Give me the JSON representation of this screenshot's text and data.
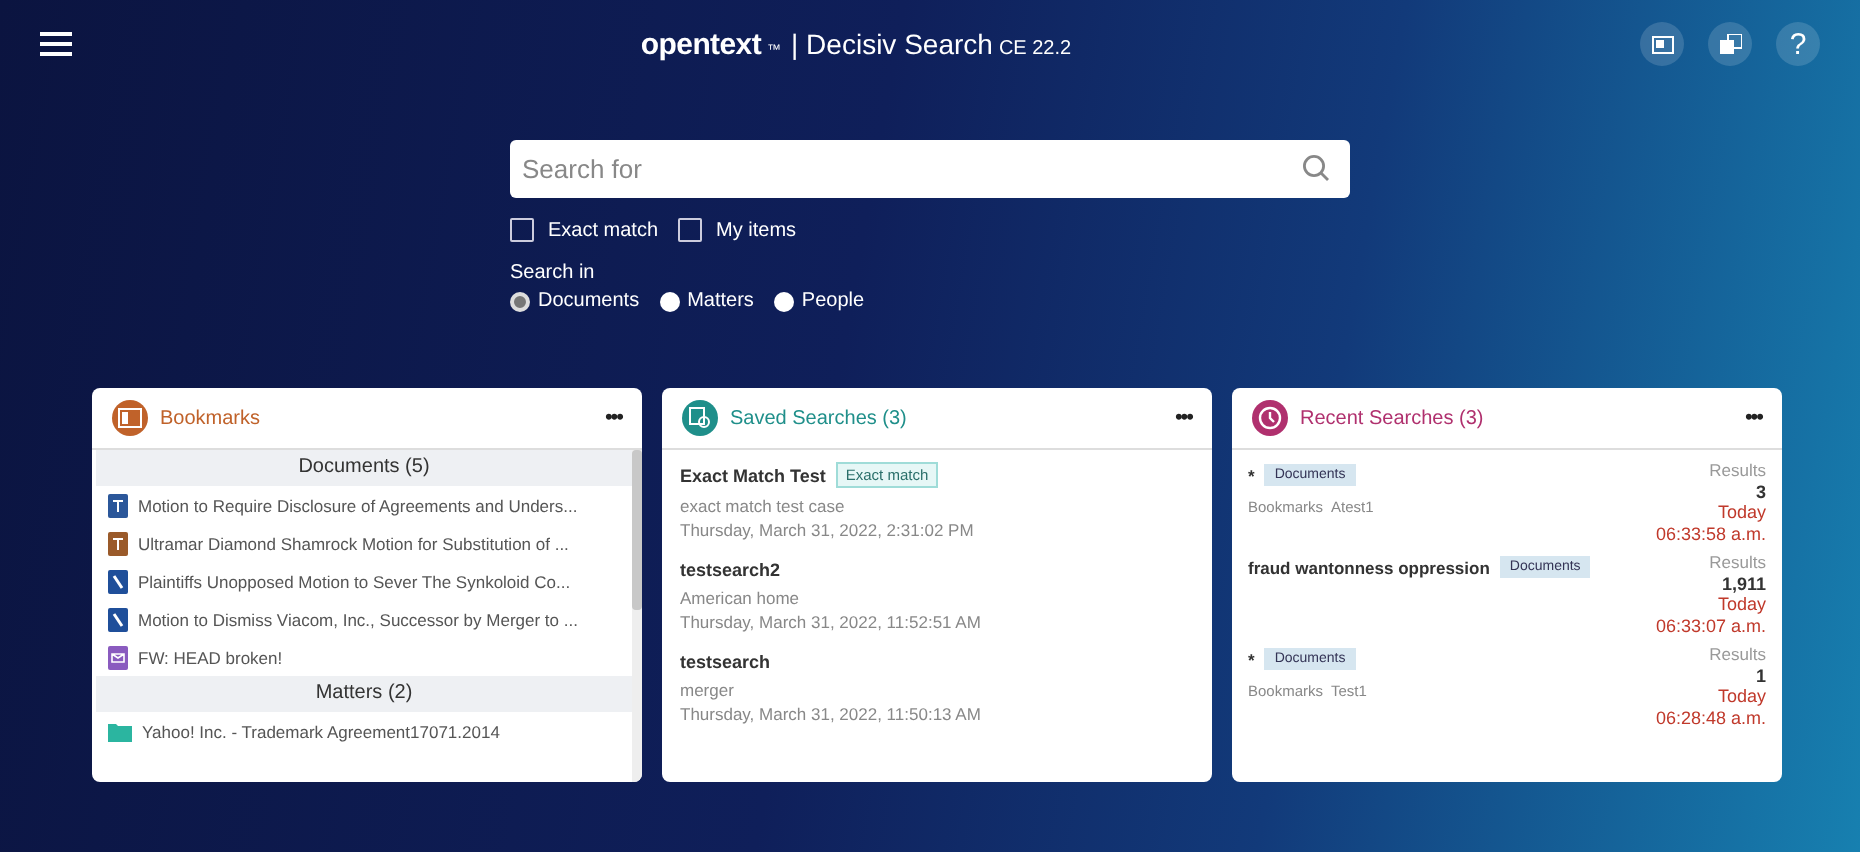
{
  "header": {
    "brand": "opentext",
    "brand_mark": "™",
    "title": "| Decisiv Search",
    "version": "CE 22.2",
    "help": "?"
  },
  "search": {
    "placeholder": "Search for"
  },
  "options": [
    {
      "label": "Exact match",
      "checked": false
    },
    {
      "label": "My items",
      "checked": false
    }
  ],
  "search_in": {
    "label": "Search in",
    "choices": [
      {
        "label": "Documents",
        "selected": true
      },
      {
        "label": "Matters",
        "selected": false
      },
      {
        "label": "People",
        "selected": false
      }
    ]
  },
  "bookmarks": {
    "title": "Bookmarks",
    "color": "#c0622a",
    "more": "•••",
    "groups": [
      {
        "heading": "Documents (5)",
        "items": [
          {
            "kind": "word",
            "text": "Motion to Require Disclosure of Agreements and Unders..."
          },
          {
            "kind": "tiff",
            "text": "Ultramar Diamond Shamrock Motion for Substitution of ..."
          },
          {
            "kind": "pdf",
            "text": "Plaintiffs Unopposed Motion to Sever The Synkoloid Co..."
          },
          {
            "kind": "pdf",
            "text": "Motion to Dismiss Viacom, Inc., Successor by Merger to ..."
          },
          {
            "kind": "email",
            "text": "FW: HEAD broken!"
          }
        ]
      },
      {
        "heading": "Matters (2)",
        "items": [
          {
            "kind": "folder",
            "text": "Yahoo! Inc. - Trademark Agreement17071.2014"
          }
        ]
      }
    ]
  },
  "saved_searches": {
    "title": "Saved Searches (3)",
    "color": "#1f8f8a",
    "more": "•••",
    "items": [
      {
        "name": "Exact Match Test",
        "tag": "Exact match",
        "query": "exact match test case",
        "date": "Thursday, March 31, 2022, 2:31:02 PM"
      },
      {
        "name": "testsearch2",
        "query": "American home",
        "date": "Thursday, March 31, 2022, 11:52:51 AM"
      },
      {
        "name": "testsearch",
        "query": "merger",
        "date": "Thursday, March 31, 2022, 11:50:13 AM"
      }
    ]
  },
  "recent_searches": {
    "title": "Recent Searches (3)",
    "color": "#b0306e",
    "more": "•••",
    "items": [
      {
        "query": "*",
        "tag": "Documents",
        "scope": "Bookmarks",
        "scope_name": "Atest1",
        "results_label": "Results",
        "count": "3",
        "day": "Today",
        "time": "06:33:58 a.m."
      },
      {
        "query": "fraud wantonness oppression",
        "tag": "Documents",
        "results_label": "Results",
        "count": "1,911",
        "day": "Today",
        "time": "06:33:07 a.m."
      },
      {
        "query": "*",
        "tag": "Documents",
        "scope": "Bookmarks",
        "scope_name": "Test1",
        "results_label": "Results",
        "count": "1",
        "day": "Today",
        "time": "06:28:48 a.m."
      }
    ]
  }
}
